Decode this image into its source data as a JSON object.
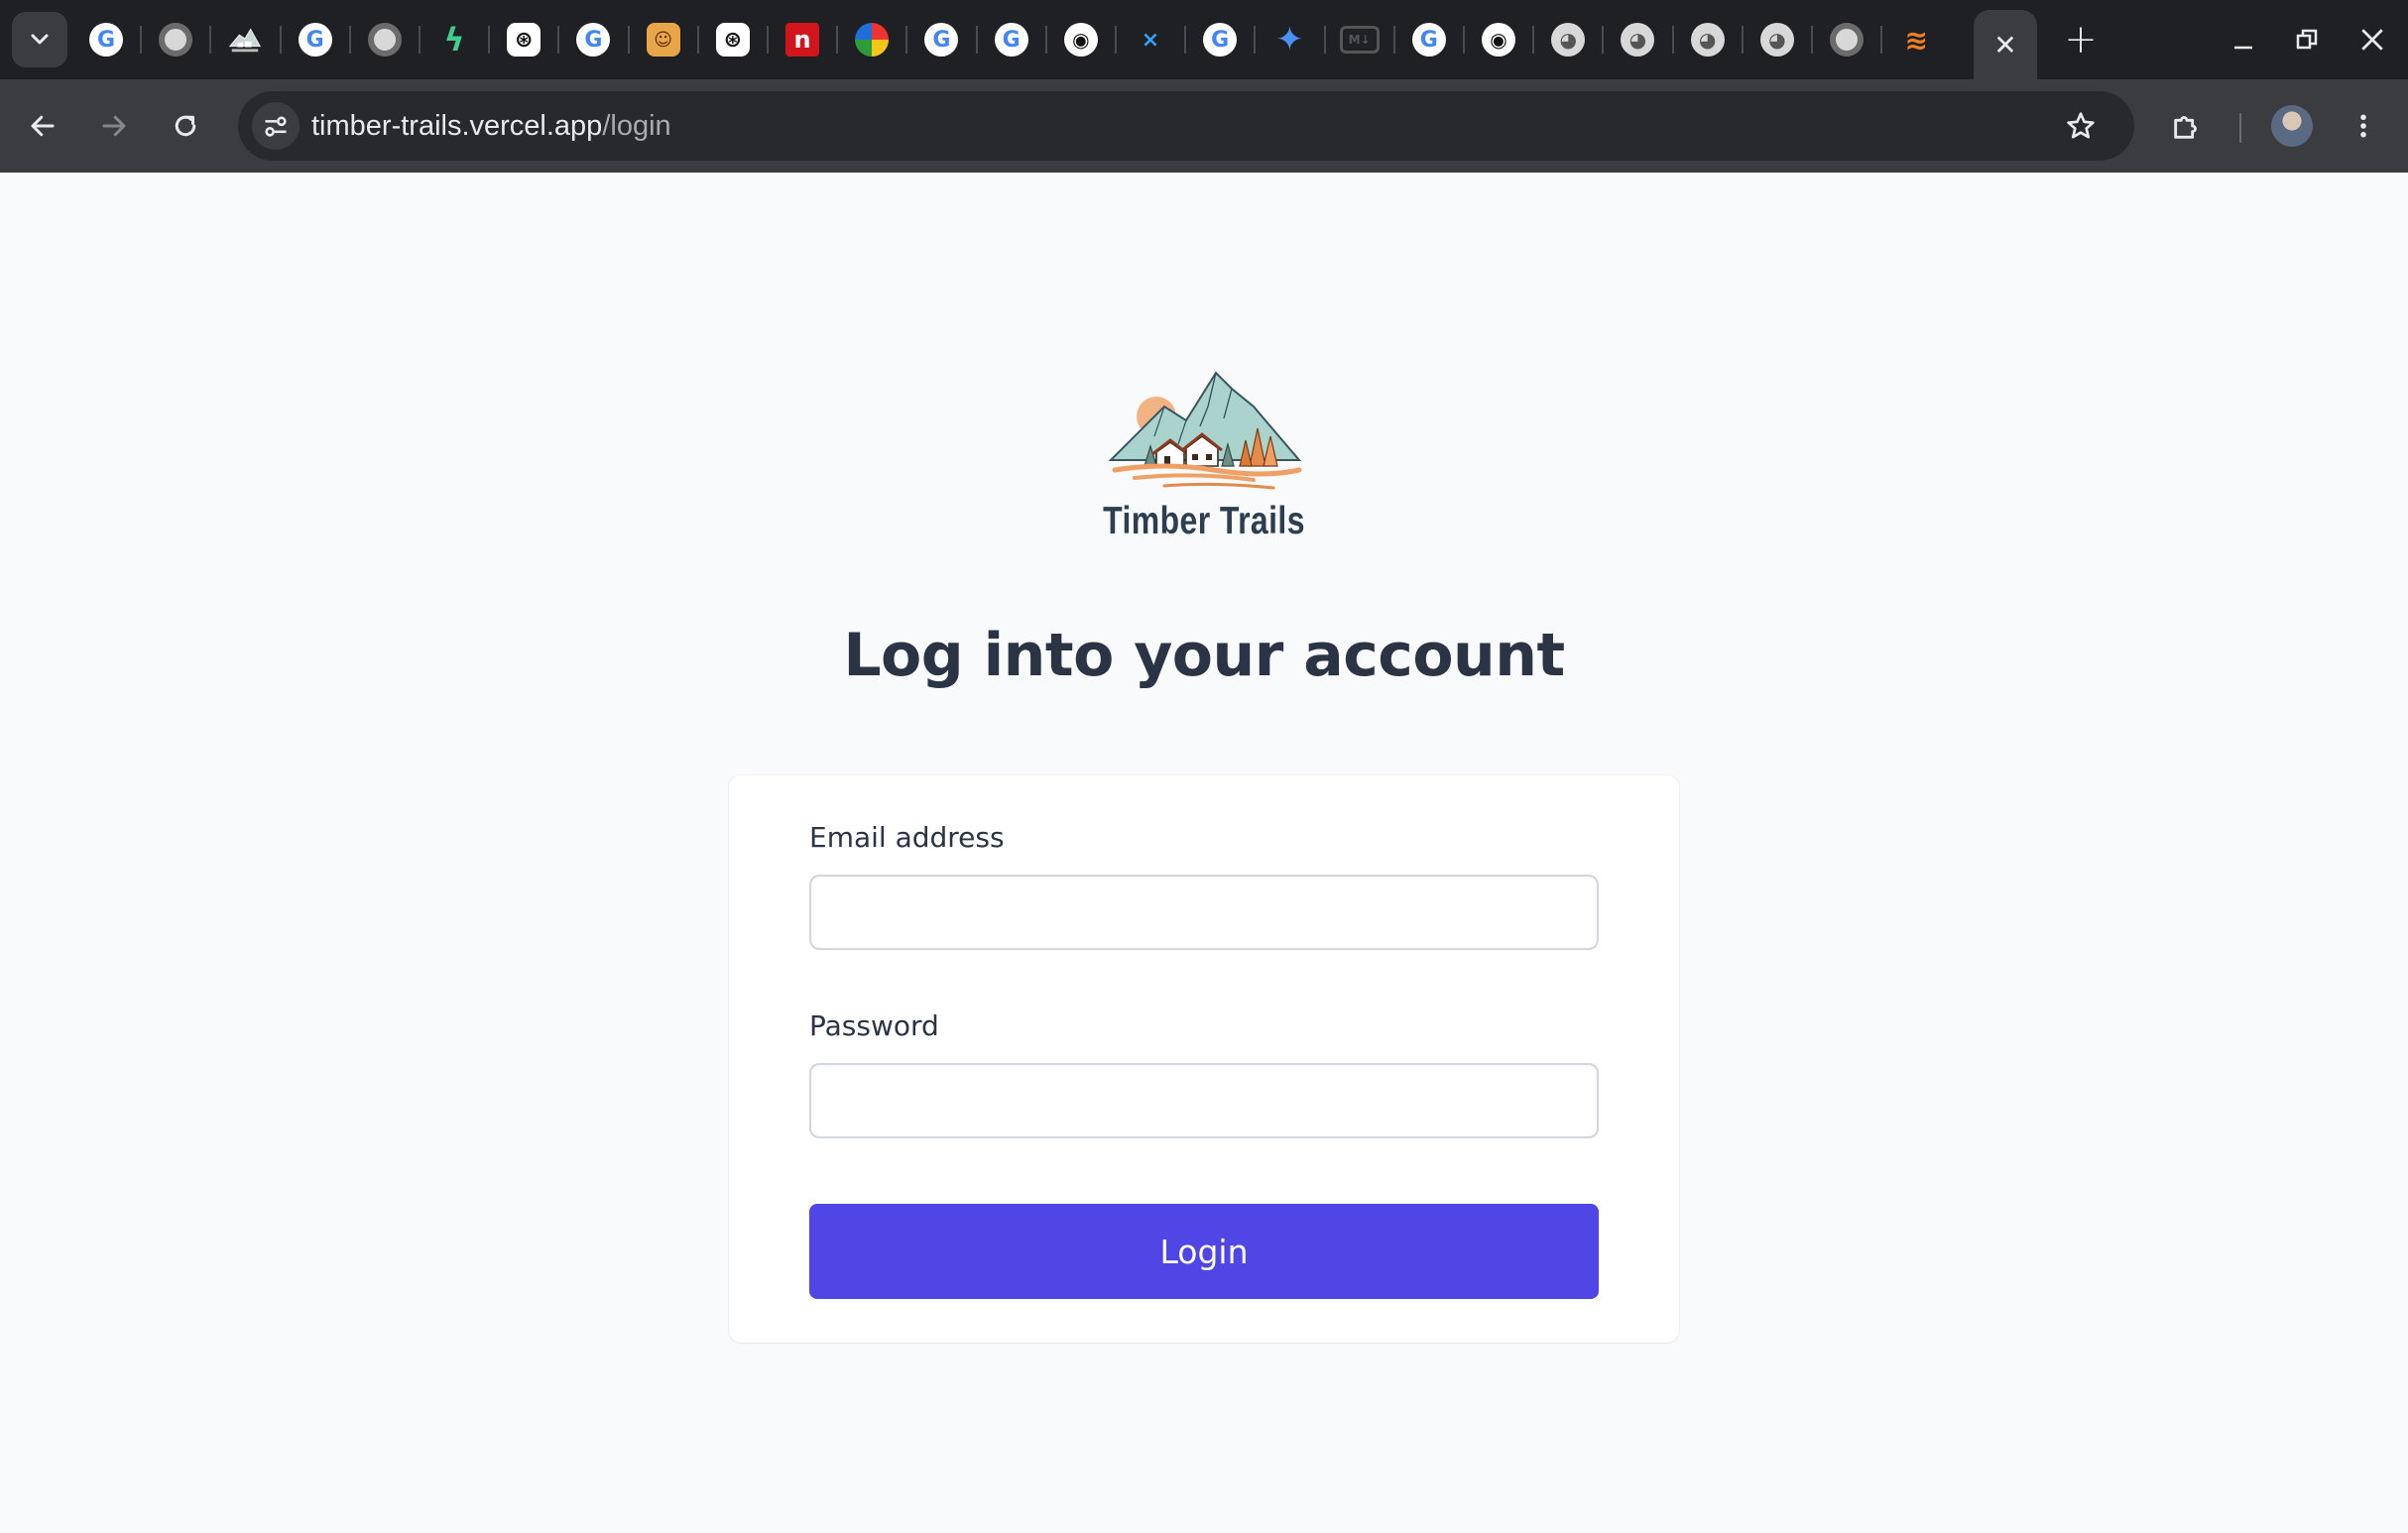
{
  "browser": {
    "tabs": [
      {
        "icon": "google-icon"
      },
      {
        "icon": "chrome-icon"
      },
      {
        "icon": "timber-trails-icon"
      },
      {
        "icon": "google-icon"
      },
      {
        "icon": "chrome-icon"
      },
      {
        "icon": "supabase-icon"
      },
      {
        "icon": "openai-icon"
      },
      {
        "icon": "google-icon"
      },
      {
        "icon": "avatar-face-icon"
      },
      {
        "icon": "openai-icon"
      },
      {
        "icon": "netflix-n-icon"
      },
      {
        "icon": "swirl-icon"
      },
      {
        "icon": "google-icon"
      },
      {
        "icon": "google-icon"
      },
      {
        "icon": "github-icon"
      },
      {
        "icon": "x-app-icon"
      },
      {
        "icon": "google-icon"
      },
      {
        "icon": "gemini-sparkle-icon"
      },
      {
        "icon": "markdown-icon"
      },
      {
        "icon": "google-icon"
      },
      {
        "icon": "github-icon"
      },
      {
        "icon": "globe-icon"
      },
      {
        "icon": "globe-icon"
      },
      {
        "icon": "globe-icon"
      },
      {
        "icon": "globe-icon"
      },
      {
        "icon": "chrome-icon"
      },
      {
        "icon": "stackoverflow-icon"
      }
    ],
    "active_tab_close": "✕",
    "new_tab": "+",
    "url_host": "timber-trails.vercel.app",
    "url_path": "/login"
  },
  "brand": {
    "name": "Timber Trails"
  },
  "page": {
    "title": "Log into your account"
  },
  "form": {
    "email_label": "Email address",
    "email_value": "",
    "password_label": "Password",
    "password_value": "",
    "submit_label": "Login"
  },
  "colors": {
    "accent": "#4f46e5",
    "heading": "#2b3445",
    "background": "#f8fafc"
  }
}
